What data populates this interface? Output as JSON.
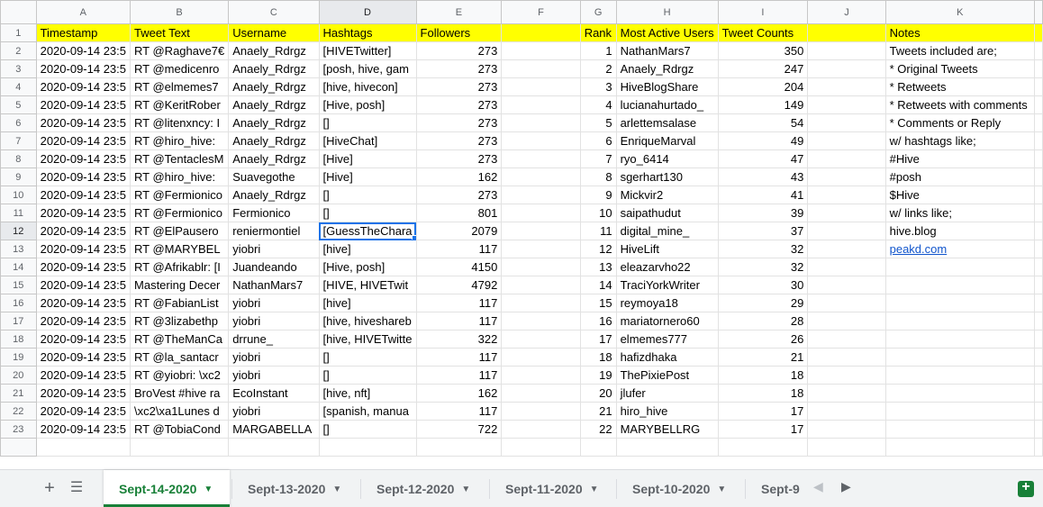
{
  "columns": [
    "A",
    "B",
    "C",
    "D",
    "E",
    "F",
    "G",
    "H",
    "I",
    "J",
    "K"
  ],
  "header_row": [
    "Timestamp",
    "Tweet Text",
    "Username",
    "Hashtags",
    "Followers",
    "",
    "Rank",
    "Most Active Users",
    "Tweet Counts",
    "",
    "Notes"
  ],
  "rows": [
    [
      "2020-09-14 23:5",
      "RT @Raghave7€",
      "Anaely_Rdrgz",
      "[HIVETwitter]",
      "273",
      "",
      "1",
      "NathanMars7",
      "350",
      "",
      "Tweets included are;"
    ],
    [
      "2020-09-14 23:5",
      "RT @medicenro",
      "Anaely_Rdrgz",
      "[posh, hive, gam",
      "273",
      "",
      "2",
      "Anaely_Rdrgz",
      "247",
      "",
      "* Original Tweets"
    ],
    [
      "2020-09-14 23:5",
      "RT @elmemes7",
      "Anaely_Rdrgz",
      "[hive, hivecon]",
      "273",
      "",
      "3",
      "HiveBlogShare",
      "204",
      "",
      "* Retweets"
    ],
    [
      "2020-09-14 23:5",
      "RT @KeritRober",
      "Anaely_Rdrgz",
      "[Hive, posh]",
      "273",
      "",
      "4",
      "lucianahurtado_",
      "149",
      "",
      "* Retweets with comments"
    ],
    [
      "2020-09-14 23:5",
      "RT @litenxncy: I",
      "Anaely_Rdrgz",
      "[]",
      "273",
      "",
      "5",
      "arlettemsalase",
      "54",
      "",
      "* Comments or Reply"
    ],
    [
      "2020-09-14 23:5",
      "RT @hiro_hive:",
      "Anaely_Rdrgz",
      "[HiveChat]",
      "273",
      "",
      "6",
      "EnriqueMarval",
      "49",
      "",
      "w/ hashtags like;"
    ],
    [
      "2020-09-14 23:5",
      "RT @TentaclesM",
      "Anaely_Rdrgz",
      "[Hive]",
      "273",
      "",
      "7",
      "ryo_6414",
      "47",
      "",
      "#Hive"
    ],
    [
      "2020-09-14 23:5",
      "RT @hiro_hive:",
      "Suavegothe",
      "[Hive]",
      "162",
      "",
      "8",
      "sgerhart130",
      "43",
      "",
      "#posh"
    ],
    [
      "2020-09-14 23:5",
      "RT @Fermionico",
      "Anaely_Rdrgz",
      "[]",
      "273",
      "",
      "9",
      "Mickvir2",
      "41",
      "",
      "$Hive"
    ],
    [
      "2020-09-14 23:5",
      "RT @Fermionico",
      "Fermionico",
      "[]",
      "801",
      "",
      "10",
      "saipathudut",
      "39",
      "",
      "w/ links like;"
    ],
    [
      "2020-09-14 23:5",
      "RT @ElPausero",
      "reniermontiel",
      "[GuessTheChara",
      "2079",
      "",
      "11",
      "digital_mine_",
      "37",
      "",
      "hive.blog"
    ],
    [
      "2020-09-14 23:5",
      "RT @MARYBEL",
      "yiobri",
      "[hive]",
      "117",
      "",
      "12",
      "HiveLift",
      "32",
      "",
      "peakd.com"
    ],
    [
      "2020-09-14 23:5",
      "RT @Afrikablr: [I",
      "Juandeando",
      "[Hive, posh]",
      "4150",
      "",
      "13",
      "eleazarvho22",
      "32",
      "",
      ""
    ],
    [
      "2020-09-14 23:5",
      "Mastering Decer",
      "NathanMars7",
      "[HIVE, HIVETwit",
      "4792",
      "",
      "14",
      "TraciYorkWriter",
      "30",
      "",
      ""
    ],
    [
      "2020-09-14 23:5",
      "RT @FabianList",
      "yiobri",
      "[hive]",
      "117",
      "",
      "15",
      "reymoya18",
      "29",
      "",
      ""
    ],
    [
      "2020-09-14 23:5",
      "RT @3lizabethp",
      "yiobri",
      "[hive, hiveshareb",
      "117",
      "",
      "16",
      "mariatornero60",
      "28",
      "",
      ""
    ],
    [
      "2020-09-14 23:5",
      "RT @TheManCa",
      "drrune_",
      "[hive, HIVETwitte",
      "322",
      "",
      "17",
      "elmemes777",
      "26",
      "",
      ""
    ],
    [
      "2020-09-14 23:5",
      "RT @la_santacr",
      "yiobri",
      "[]",
      "117",
      "",
      "18",
      "hafizdhaka",
      "21",
      "",
      ""
    ],
    [
      "2020-09-14 23:5",
      "RT @yiobri: \\xc2",
      "yiobri",
      "[]",
      "117",
      "",
      "19",
      "ThePixiePost",
      "18",
      "",
      ""
    ],
    [
      "2020-09-14 23:5",
      "BroVest #hive ra",
      "EcoInstant",
      "[hive, nft]",
      "162",
      "",
      "20",
      "jlufer",
      "18",
      "",
      ""
    ],
    [
      "2020-09-14 23:5",
      "\\xc2\\xa1Lunes d",
      "yiobri",
      "[spanish, manua",
      "117",
      "",
      "21",
      "hiro_hive",
      "17",
      "",
      ""
    ],
    [
      "2020-09-14 23:5",
      "RT @TobiaCond",
      "MARGABELLA",
      "[]",
      "722",
      "",
      "22",
      "MARYBELLRG",
      "17",
      "",
      ""
    ]
  ],
  "sheet_tabs": [
    "Sept-14-2020",
    "Sept-13-2020",
    "Sept-12-2020",
    "Sept-11-2020",
    "Sept-10-2020",
    "Sept-9"
  ],
  "active_tab": "Sept-14-2020",
  "selected_cell": "D12",
  "colors": {
    "header_fill": "#ffff00",
    "accent": "#188038",
    "selection": "#1a73e8",
    "link": "#1155cc"
  },
  "icons": {
    "add_sheet": "plus-icon",
    "all_sheets": "menu-icon",
    "scroll_left": "chevron-left-icon",
    "scroll_right": "chevron-right-icon",
    "explore": "explore-icon"
  }
}
